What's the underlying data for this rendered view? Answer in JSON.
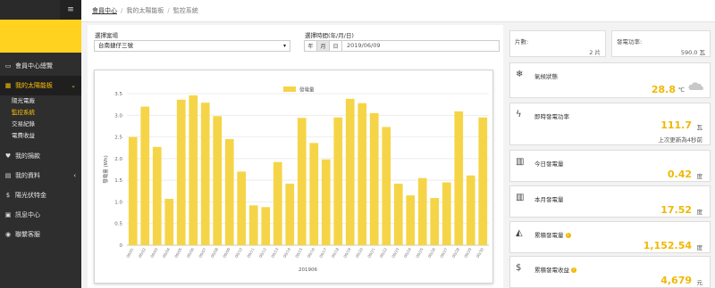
{
  "sidebar": {
    "menu_glyph": "≡",
    "items": [
      {
        "icon": "monitor-icon",
        "glyph": "▭",
        "label": "會員中心總覽"
      },
      {
        "icon": "solar-panel-icon",
        "glyph": "▦",
        "label": "我的太陽能板",
        "chevron": "⌄"
      },
      {
        "icon": "heart-icon",
        "glyph": "♥",
        "label": "我的捐款"
      },
      {
        "icon": "id-card-icon",
        "glyph": "▤",
        "label": "我的資料",
        "chevron": "‹"
      },
      {
        "icon": "dollar-icon",
        "glyph": "$",
        "label": "陽光伏特金"
      },
      {
        "icon": "message-icon",
        "glyph": "▣",
        "label": "訊息中心"
      },
      {
        "icon": "support-icon",
        "glyph": "◉",
        "label": "聯繫客服"
      }
    ],
    "sub_items": [
      "陽光電廠",
      "監控系統",
      "交易紀錄",
      "電費收益"
    ]
  },
  "breadcrumb": {
    "items": [
      "會員中心",
      "我的太陽能板",
      "監控系統"
    ]
  },
  "filters": {
    "site_label": "選擇案場",
    "site_value": "台南捷仔三號",
    "site_arrow": "▾",
    "time_label": "選擇時間(年/月/日)",
    "period_buttons": [
      "年",
      "月",
      "日"
    ],
    "date_value": "2019/06/09"
  },
  "chart_data": {
    "type": "bar",
    "legend": "發電量",
    "ylabel": "發電量 (Wh)",
    "xlabel": "201906",
    "ylim": [
      0,
      3.5
    ],
    "yticks": [
      "0",
      "0.5",
      "1.0",
      "1.5",
      "2.0",
      "2.5",
      "3.0",
      "3.5"
    ],
    "categories": [
      "06/01",
      "06/02",
      "06/03",
      "06/04",
      "06/05",
      "06/06",
      "06/07",
      "06/08",
      "06/09",
      "06/10",
      "06/11",
      "06/12",
      "06/13",
      "06/14",
      "06/15",
      "06/16",
      "06/17",
      "06/18",
      "06/19",
      "06/20",
      "06/21",
      "06/22",
      "06/23",
      "06/24",
      "06/25",
      "06/26",
      "06/27",
      "06/28",
      "06/29",
      "06/30"
    ],
    "values": [
      2.5,
      3.2,
      2.27,
      1.07,
      3.36,
      3.46,
      3.29,
      2.98,
      2.45,
      1.7,
      0.92,
      0.88,
      1.92,
      1.42,
      2.94,
      2.36,
      1.98,
      2.95,
      3.38,
      3.28,
      3.05,
      2.73,
      1.42,
      1.15,
      1.55,
      1.09,
      1.45,
      3.09,
      1.61,
      2.95
    ],
    "bar_color": "#f5d547",
    "grid": true
  },
  "stats": {
    "pieces_label": "片數:",
    "pieces_value": "2 片",
    "capacity_label": "發電功率:",
    "capacity_value": "590.0 瓦",
    "weather": {
      "icon": "snowflake-icon",
      "glyph": "❄",
      "label": "氣候狀態",
      "value": "28.8",
      "unit": "℃"
    },
    "power": {
      "icon": "bolt-icon",
      "glyph": "ϟ",
      "label": "即時發電功率",
      "value": "111.7",
      "unit": "瓦",
      "note": "上次更新為4秒前"
    },
    "today": {
      "icon": "bar-chart-icon",
      "glyph": "▥",
      "label": "今日發電量",
      "value": "0.42",
      "unit": "度"
    },
    "month": {
      "icon": "bar-chart-icon",
      "glyph": "▥",
      "label": "本月發電量",
      "value": "17.52",
      "unit": "度"
    },
    "total": {
      "icon": "area-chart-icon",
      "glyph": "◭",
      "label": "累積發電量",
      "value": "1,152.54",
      "unit": "度"
    },
    "income": {
      "icon": "dollar-icon",
      "glyph": "$",
      "label": "累積發電收益",
      "value": "4,679",
      "unit": "元"
    }
  },
  "colors": {
    "accent": "#ffc107",
    "brand": "#ffd21f",
    "value": "#f0b800",
    "sidebar": "#2e2e2e"
  }
}
